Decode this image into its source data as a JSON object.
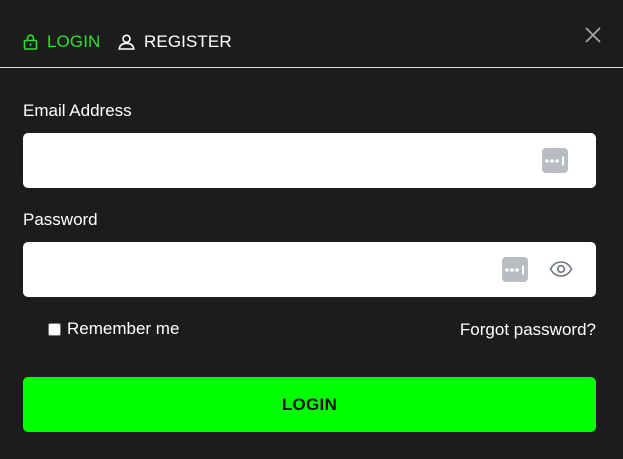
{
  "tabs": {
    "login_label": "LOGIN",
    "register_label": "REGISTER",
    "active": "login"
  },
  "form": {
    "email_label": "Email Address",
    "email_value": "",
    "password_label": "Password",
    "password_value": "",
    "remember_label": "Remember me",
    "remember_checked": false,
    "forgot_label": "Forgot password?",
    "submit_label": "LOGIN"
  },
  "icons": {
    "login_tab": "lock-icon",
    "register_tab": "user-icon",
    "close": "close-icon",
    "password_manager": "password-manager-icon",
    "show_password": "eye-icon"
  },
  "colors": {
    "background": "#1c1c1d",
    "accent": "#00ff00",
    "active_tab": "#2fe02a",
    "field_bg": "#ffffff",
    "pm_icon_bg": "#b9bcc3"
  }
}
